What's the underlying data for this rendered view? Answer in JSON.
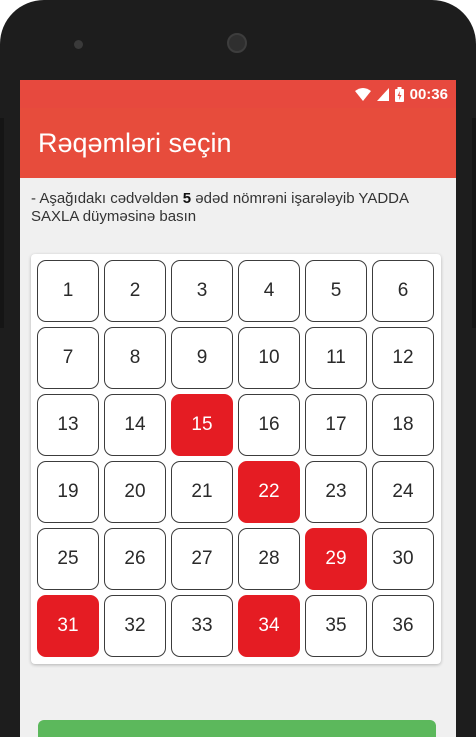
{
  "status": {
    "time": "00:36"
  },
  "appbar": {
    "title": "Rəqəmləri seçin"
  },
  "instruction": {
    "prefix": "- Aşağıdakı cədvəldən ",
    "count": "5",
    "suffix": " ədəd nömrəni işarələyib YADDA SAXLA düyməsinə basın"
  },
  "grid": {
    "numbers": [
      "1",
      "2",
      "3",
      "4",
      "5",
      "6",
      "7",
      "8",
      "9",
      "10",
      "11",
      "12",
      "13",
      "14",
      "15",
      "16",
      "17",
      "18",
      "19",
      "20",
      "21",
      "22",
      "23",
      "24",
      "25",
      "26",
      "27",
      "28",
      "29",
      "30",
      "31",
      "32",
      "33",
      "34",
      "35",
      "36"
    ],
    "selected": [
      "15",
      "22",
      "29",
      "31",
      "34"
    ]
  },
  "colors": {
    "statusbar": "#e7493e",
    "appbar": "#e74c3c",
    "selected": "#e51c23",
    "save_button": "#5cb85c"
  }
}
